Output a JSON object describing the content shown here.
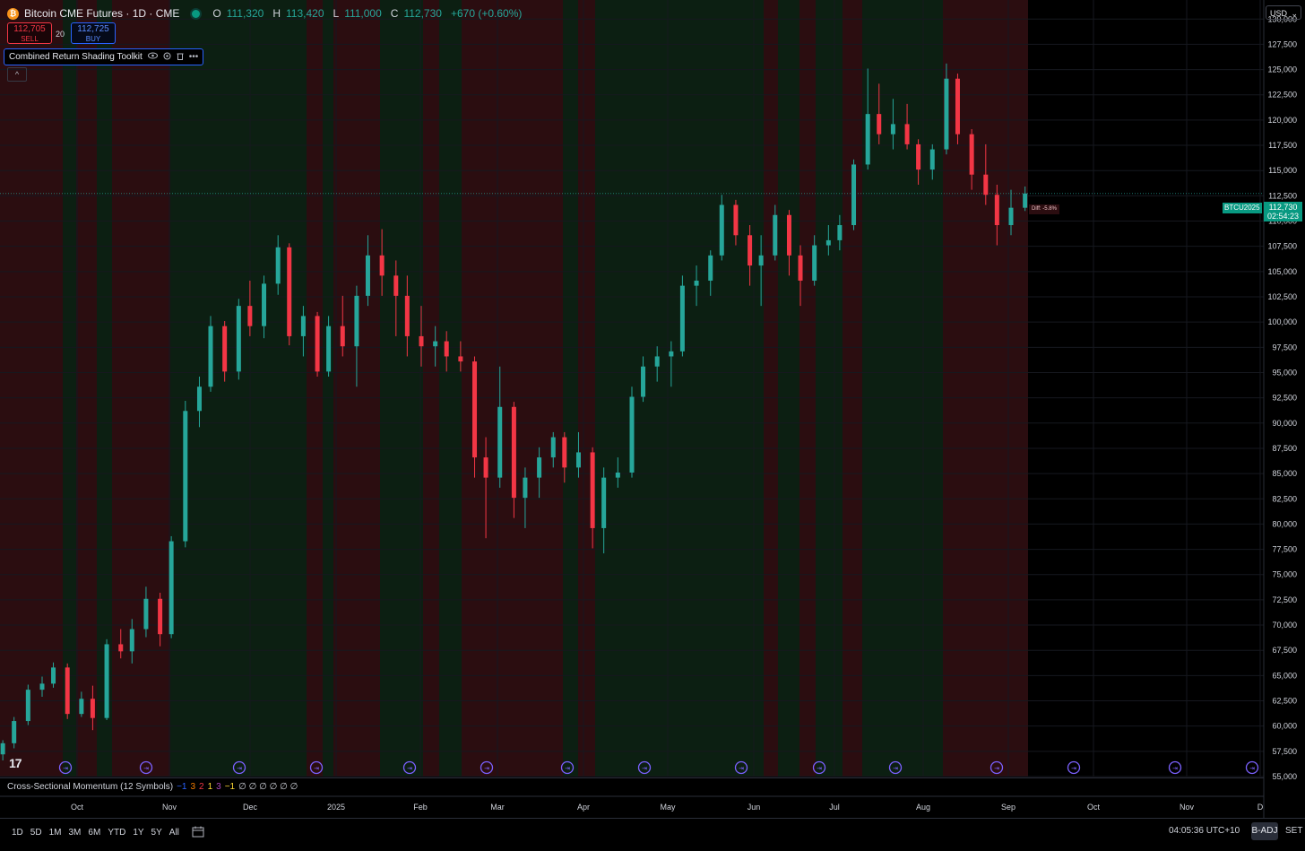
{
  "header": {
    "logo_glyph": "₿",
    "title": "Bitcoin CME Futures · 1D · CME",
    "ohlc": {
      "o_label": "O",
      "o": "111,320",
      "h_label": "H",
      "h": "113,420",
      "l_label": "L",
      "l": "111,000",
      "c_label": "C",
      "c": "112,730",
      "change": "+670 (+0.60%)"
    }
  },
  "trade": {
    "sell_price": "112,705",
    "sell_label": "SELL",
    "spread": "20",
    "buy_price": "112,725",
    "buy_label": "BUY"
  },
  "indicator": {
    "name": "Combined Return Shading Toolkit"
  },
  "collapse_glyph": "^",
  "currency": "USD",
  "tv_logo": "17",
  "price_label": {
    "symbol": "BTCU2025",
    "price": "112,730",
    "countdown": "02:54:23",
    "diff": "Diff: -5.8%"
  },
  "lower_pane": {
    "title": "Cross-Sectional Momentum (12 Symbols)",
    "values": [
      "−1",
      "3",
      "2",
      "1",
      "3",
      "−1",
      "∅ ∅ ∅ ∅ ∅ ∅"
    ]
  },
  "bottom_bar": {
    "ranges": [
      "1D",
      "5D",
      "1M",
      "3M",
      "6M",
      "YTD",
      "1Y",
      "5Y",
      "All"
    ],
    "clock": "04:05:36 UTC+10",
    "adj": "B-ADJ",
    "session": "SET"
  },
  "colors": {
    "up": "#26a69a",
    "down": "#f23645",
    "green_shade": "#0c1f12",
    "red_shade": "#2b0d10",
    "price_tag": "#089981",
    "event_marker": "#7b61ff"
  },
  "chart_data": {
    "type": "candlestick",
    "x_ticks": [
      "Oct",
      "Nov",
      "Dec",
      "2025",
      "Feb",
      "Mar",
      "Apr",
      "May",
      "Jun",
      "Jul",
      "Aug",
      "Sep",
      "Oct",
      "Nov",
      "D"
    ],
    "y_ticks": [
      55000,
      57500,
      60000,
      62500,
      65000,
      67500,
      70000,
      72500,
      75000,
      77500,
      80000,
      82500,
      85000,
      87500,
      90000,
      92500,
      95000,
      97500,
      100000,
      102500,
      105000,
      107500,
      110000,
      112500,
      115000,
      117500,
      120000,
      122500,
      125000,
      127500,
      130000
    ],
    "ylim": [
      55000,
      131000
    ],
    "last_price": 112730,
    "regimes": [
      {
        "x0": 0,
        "x1": 70,
        "r": "down"
      },
      {
        "x0": 70,
        "x1": 85,
        "r": "up"
      },
      {
        "x0": 85,
        "x1": 108,
        "r": "down"
      },
      {
        "x0": 108,
        "x1": 125,
        "r": "up"
      },
      {
        "x0": 125,
        "x1": 190,
        "r": "down"
      },
      {
        "x0": 190,
        "x1": 342,
        "r": "up"
      },
      {
        "x0": 342,
        "x1": 360,
        "r": "down"
      },
      {
        "x0": 360,
        "x1": 372,
        "r": "up"
      },
      {
        "x0": 372,
        "x1": 424,
        "r": "down"
      },
      {
        "x0": 424,
        "x1": 472,
        "r": "up"
      },
      {
        "x0": 472,
        "x1": 490,
        "r": "down"
      },
      {
        "x0": 490,
        "x1": 515,
        "r": "up"
      },
      {
        "x0": 515,
        "x1": 628,
        "r": "down"
      },
      {
        "x0": 628,
        "x1": 645,
        "r": "up"
      },
      {
        "x0": 645,
        "x1": 664,
        "r": "down"
      },
      {
        "x0": 664,
        "x1": 852,
        "r": "up"
      },
      {
        "x0": 852,
        "x1": 868,
        "r": "down"
      },
      {
        "x0": 868,
        "x1": 892,
        "r": "up"
      },
      {
        "x0": 892,
        "x1": 910,
        "r": "down"
      },
      {
        "x0": 910,
        "x1": 940,
        "r": "up"
      },
      {
        "x0": 940,
        "x1": 962,
        "r": "down"
      },
      {
        "x0": 962,
        "x1": 1052,
        "r": "up"
      },
      {
        "x0": 1052,
        "x1": 1147,
        "r": "down"
      }
    ],
    "event_markers": [
      "⇥",
      "⇥",
      "⇥",
      "⇥",
      "⇥",
      "⇥",
      "⇥",
      "⇥",
      "⇥",
      "⇥",
      "⇥",
      "⇥",
      "⇥",
      "⇥",
      "⇥"
    ],
    "candles": [
      {
        "t": "2024-09-09",
        "o": 57200,
        "h": 58600,
        "l": 56600,
        "c": 58300
      },
      {
        "t": "2024-09-13",
        "o": 58300,
        "h": 60900,
        "l": 57800,
        "c": 60500
      },
      {
        "t": "2024-09-18",
        "o": 60500,
        "h": 64100,
        "l": 60100,
        "c": 63600
      },
      {
        "t": "2024-09-23",
        "o": 63600,
        "h": 64900,
        "l": 62900,
        "c": 64200
      },
      {
        "t": "2024-09-27",
        "o": 64200,
        "h": 66300,
        "l": 63800,
        "c": 65800
      },
      {
        "t": "2024-10-02",
        "o": 65800,
        "h": 66200,
        "l": 60700,
        "c": 61200
      },
      {
        "t": "2024-10-07",
        "o": 61200,
        "h": 63400,
        "l": 60900,
        "c": 62700
      },
      {
        "t": "2024-10-11",
        "o": 62700,
        "h": 64000,
        "l": 59600,
        "c": 60800
      },
      {
        "t": "2024-10-16",
        "o": 60800,
        "h": 68600,
        "l": 60600,
        "c": 68100
      },
      {
        "t": "2024-10-21",
        "o": 68100,
        "h": 69600,
        "l": 66700,
        "c": 67400
      },
      {
        "t": "2024-10-25",
        "o": 67400,
        "h": 70600,
        "l": 66200,
        "c": 69600
      },
      {
        "t": "2024-10-30",
        "o": 69600,
        "h": 73800,
        "l": 68800,
        "c": 72600
      },
      {
        "t": "2024-11-04",
        "o": 72600,
        "h": 73200,
        "l": 67900,
        "c": 69100
      },
      {
        "t": "2024-11-08",
        "o": 69100,
        "h": 78800,
        "l": 68700,
        "c": 78300
      },
      {
        "t": "2024-11-13",
        "o": 78300,
        "h": 92200,
        "l": 77700,
        "c": 91200
      },
      {
        "t": "2024-11-18",
        "o": 91200,
        "h": 94600,
        "l": 89600,
        "c": 93600
      },
      {
        "t": "2024-11-22",
        "o": 93600,
        "h": 100600,
        "l": 93100,
        "c": 99600
      },
      {
        "t": "2024-11-27",
        "o": 99600,
        "h": 100100,
        "l": 94100,
        "c": 95100
      },
      {
        "t": "2024-12-02",
        "o": 95100,
        "h": 102300,
        "l": 94300,
        "c": 101600
      },
      {
        "t": "2024-12-06",
        "o": 101600,
        "h": 104100,
        "l": 98600,
        "c": 99600
      },
      {
        "t": "2024-12-11",
        "o": 99600,
        "h": 104600,
        "l": 98400,
        "c": 103800
      },
      {
        "t": "2024-12-16",
        "o": 103800,
        "h": 108600,
        "l": 102700,
        "c": 107400
      },
      {
        "t": "2024-12-20",
        "o": 107400,
        "h": 107800,
        "l": 97700,
        "c": 98600
      },
      {
        "t": "2024-12-25",
        "o": 98600,
        "h": 101600,
        "l": 96600,
        "c": 100600
      },
      {
        "t": "2024-12-30",
        "o": 100600,
        "h": 101000,
        "l": 94600,
        "c": 95100
      },
      {
        "t": "2025-01-03",
        "o": 95100,
        "h": 100600,
        "l": 94600,
        "c": 99600
      },
      {
        "t": "2025-01-08",
        "o": 99600,
        "h": 102600,
        "l": 96600,
        "c": 97600
      },
      {
        "t": "2025-01-13",
        "o": 97600,
        "h": 103600,
        "l": 93600,
        "c": 102600
      },
      {
        "t": "2025-01-17",
        "o": 102600,
        "h": 108600,
        "l": 101600,
        "c": 106600
      },
      {
        "t": "2025-01-22",
        "o": 106600,
        "h": 109200,
        "l": 102600,
        "c": 104600
      },
      {
        "t": "2025-01-27",
        "o": 104600,
        "h": 106100,
        "l": 98600,
        "c": 102600
      },
      {
        "t": "2025-01-31",
        "o": 102600,
        "h": 104600,
        "l": 96600,
        "c": 98600
      },
      {
        "t": "2025-02-05",
        "o": 98600,
        "h": 101600,
        "l": 95600,
        "c": 97600
      },
      {
        "t": "2025-02-10",
        "o": 97600,
        "h": 99600,
        "l": 95600,
        "c": 98100
      },
      {
        "t": "2025-02-14",
        "o": 98100,
        "h": 99100,
        "l": 95100,
        "c": 96600
      },
      {
        "t": "2025-02-19",
        "o": 96600,
        "h": 98100,
        "l": 95100,
        "c": 96100
      },
      {
        "t": "2025-02-24",
        "o": 96100,
        "h": 96600,
        "l": 84600,
        "c": 86600
      },
      {
        "t": "2025-02-28",
        "o": 86600,
        "h": 88600,
        "l": 78600,
        "c": 84600
      },
      {
        "t": "2025-03-05",
        "o": 84600,
        "h": 95600,
        "l": 83600,
        "c": 91600
      },
      {
        "t": "2025-03-10",
        "o": 91600,
        "h": 92100,
        "l": 80600,
        "c": 82600
      },
      {
        "t": "2025-03-14",
        "o": 82600,
        "h": 85600,
        "l": 79600,
        "c": 84600
      },
      {
        "t": "2025-03-19",
        "o": 84600,
        "h": 87600,
        "l": 82600,
        "c": 86600
      },
      {
        "t": "2025-03-24",
        "o": 86600,
        "h": 89100,
        "l": 85600,
        "c": 88600
      },
      {
        "t": "2025-03-28",
        "o": 88600,
        "h": 89100,
        "l": 84100,
        "c": 85600
      },
      {
        "t": "2025-04-02",
        "o": 85600,
        "h": 89100,
        "l": 84600,
        "c": 87100
      },
      {
        "t": "2025-04-07",
        "o": 87100,
        "h": 87600,
        "l": 77600,
        "c": 79600
      },
      {
        "t": "2025-04-11",
        "o": 79600,
        "h": 85600,
        "l": 77100,
        "c": 84600
      },
      {
        "t": "2025-04-16",
        "o": 84600,
        "h": 86600,
        "l": 83600,
        "c": 85100
      },
      {
        "t": "2025-04-21",
        "o": 85100,
        "h": 93600,
        "l": 84600,
        "c": 92600
      },
      {
        "t": "2025-04-25",
        "o": 92600,
        "h": 96600,
        "l": 92100,
        "c": 95600
      },
      {
        "t": "2025-04-30",
        "o": 95600,
        "h": 97600,
        "l": 94100,
        "c": 96600
      },
      {
        "t": "2025-05-05",
        "o": 96600,
        "h": 98100,
        "l": 93600,
        "c": 97100
      },
      {
        "t": "2025-05-09",
        "o": 97100,
        "h": 104600,
        "l": 96600,
        "c": 103600
      },
      {
        "t": "2025-05-14",
        "o": 103600,
        "h": 105600,
        "l": 101600,
        "c": 104100
      },
      {
        "t": "2025-05-19",
        "o": 104100,
        "h": 107100,
        "l": 102600,
        "c": 106600
      },
      {
        "t": "2025-05-23",
        "o": 106600,
        "h": 112600,
        "l": 106100,
        "c": 111600
      },
      {
        "t": "2025-05-28",
        "o": 111600,
        "h": 112100,
        "l": 107600,
        "c": 108600
      },
      {
        "t": "2025-06-02",
        "o": 108600,
        "h": 109600,
        "l": 103600,
        "c": 105600
      },
      {
        "t": "2025-06-06",
        "o": 105600,
        "h": 108600,
        "l": 101600,
        "c": 106600
      },
      {
        "t": "2025-06-11",
        "o": 106600,
        "h": 111600,
        "l": 106100,
        "c": 110600
      },
      {
        "t": "2025-06-16",
        "o": 110600,
        "h": 111100,
        "l": 104600,
        "c": 106600
      },
      {
        "t": "2025-06-20",
        "o": 106600,
        "h": 107600,
        "l": 101600,
        "c": 104100
      },
      {
        "t": "2025-06-25",
        "o": 104100,
        "h": 108600,
        "l": 103600,
        "c": 107600
      },
      {
        "t": "2025-06-30",
        "o": 107600,
        "h": 109600,
        "l": 106600,
        "c": 108100
      },
      {
        "t": "2025-07-04",
        "o": 108100,
        "h": 110600,
        "l": 107100,
        "c": 109600
      },
      {
        "t": "2025-07-09",
        "o": 109600,
        "h": 116100,
        "l": 109100,
        "c": 115600
      },
      {
        "t": "2025-07-14",
        "o": 115600,
        "h": 125100,
        "l": 115100,
        "c": 120600
      },
      {
        "t": "2025-07-18",
        "o": 120600,
        "h": 123600,
        "l": 117600,
        "c": 118600
      },
      {
        "t": "2025-07-23",
        "o": 118600,
        "h": 122100,
        "l": 117100,
        "c": 119600
      },
      {
        "t": "2025-07-28",
        "o": 119600,
        "h": 121600,
        "l": 117100,
        "c": 117600
      },
      {
        "t": "2025-08-01",
        "o": 117600,
        "h": 118100,
        "l": 113600,
        "c": 115100
      },
      {
        "t": "2025-08-06",
        "o": 115100,
        "h": 117600,
        "l": 114100,
        "c": 117100
      },
      {
        "t": "2025-08-11",
        "o": 117100,
        "h": 125600,
        "l": 116600,
        "c": 124100
      },
      {
        "t": "2025-08-15",
        "o": 124100,
        "h": 124600,
        "l": 117600,
        "c": 118600
      },
      {
        "t": "2025-08-20",
        "o": 118600,
        "h": 119100,
        "l": 113100,
        "c": 114600
      },
      {
        "t": "2025-08-25",
        "o": 114600,
        "h": 117600,
        "l": 111600,
        "c": 112600
      },
      {
        "t": "2025-08-29",
        "o": 112600,
        "h": 113600,
        "l": 107600,
        "c": 109600
      },
      {
        "t": "2025-09-03",
        "o": 109600,
        "h": 113100,
        "l": 108600,
        "c": 111320
      },
      {
        "t": "2025-09-08",
        "o": 111320,
        "h": 113420,
        "l": 111000,
        "c": 112730
      }
    ]
  }
}
